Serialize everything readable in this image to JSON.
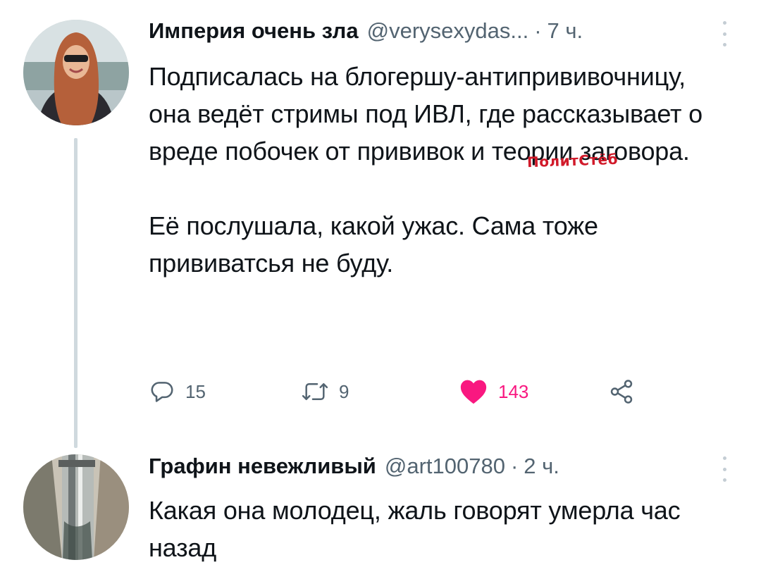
{
  "tweets": [
    {
      "author_name": "Империя очень зла",
      "author_handle": "@verysexydas...",
      "separator": "·",
      "time": "7 ч.",
      "paragraph1": "Подписалась на блогершу-антипрививочницу, она ведёт стримы под ИВЛ, где рассказывает о вреде побочек от прививок и теории заговора.",
      "paragraph2": "Её послушала, какой ужас. Сама тоже прививатсья не буду.",
      "reply_count": "15",
      "retweet_count": "9",
      "like_count": "143",
      "icons": {
        "reply": "reply-icon",
        "retweet": "retweet-icon",
        "like": "heart-icon",
        "share": "share-icon",
        "more": "more-icon"
      }
    },
    {
      "author_name": "Графин невежливый",
      "author_handle": "@art100780",
      "separator": "·",
      "time": "2 ч.",
      "text": "Какая она молодец, жаль говорят умерла час назад"
    }
  ],
  "watermark": "ПолитСтёб",
  "colors": {
    "text": "#0f1419",
    "secondary": "#536471",
    "like": "#f91880",
    "thread_line": "#cfd9de",
    "watermark": "#d11a2a"
  }
}
